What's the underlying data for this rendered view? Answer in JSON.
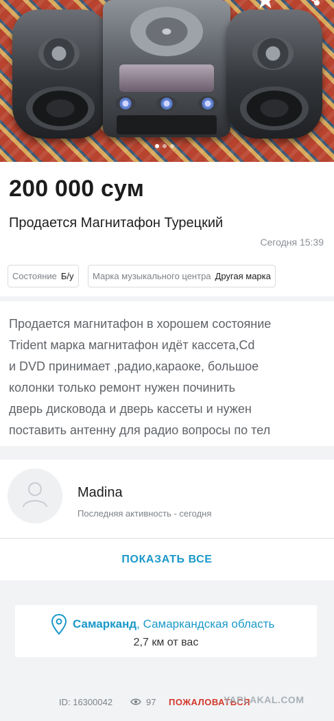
{
  "listing": {
    "price": "200 000 сум",
    "title": "Продается Магнитафон Турецкий",
    "date": "Сегодня 15:39",
    "photo_dots": 3,
    "active_photo": 1
  },
  "params": [
    {
      "key": "Состояние",
      "value": "Б/у"
    },
    {
      "key": "Марка музыкального центра",
      "value": "Другая марка"
    }
  ],
  "description": "Продается магнитафон  в хорошем состояние\nTrident марка магнитафон идёт кассета,Cd\nи DVD принимает ,радио,караоке, большое\nколонки только ремонт нужен починить\nдверь дисковода и дверь кассеты и нужен\nпоставить антенну для радио   вопросы по тел",
  "seller": {
    "name": "Madina",
    "activity": "Последняя активность - сегодня",
    "show_all_label": "ПОКАЗАТЬ ВСЕ"
  },
  "location": {
    "city": "Самарканд",
    "region": ", Самаркандская область",
    "distance": "2,7 км от вас"
  },
  "footer": {
    "id": "ID: 16300042",
    "views": "97",
    "report_label": "ПОЖАЛОВАТЬСЯ",
    "watermark": "YAPLAKAL.COM"
  },
  "colors": {
    "accent": "#1a98c9",
    "report": "#d2372a"
  },
  "icons": [
    "favorite-star-icon",
    "share-icon",
    "avatar-placeholder-icon",
    "location-pin-icon",
    "eye-icon"
  ]
}
